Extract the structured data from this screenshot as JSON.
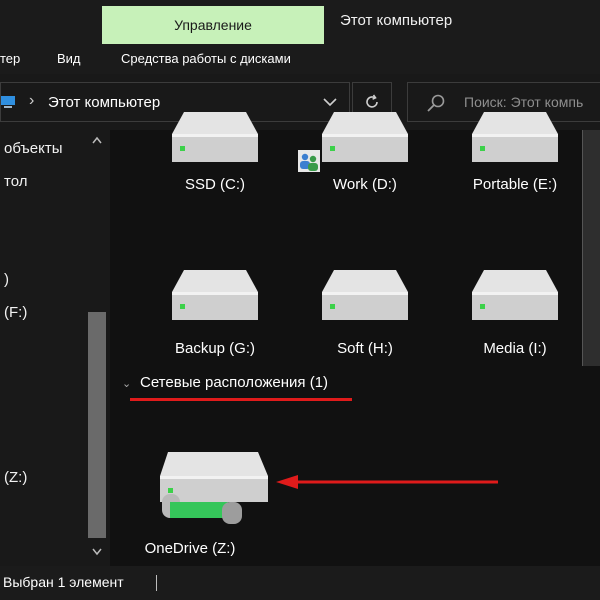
{
  "ribbon": {
    "active_context_tab": "Управление",
    "window_title": "Этот компьютер",
    "items": [
      "тер",
      "Вид",
      "Средства работы с дисками"
    ]
  },
  "address": {
    "path": "Этот компьютер",
    "search_placeholder": "Поиск: Этот компь"
  },
  "nav": {
    "items": [
      "объекты",
      "тол",
      ")",
      "(F:)",
      "(Z:)"
    ]
  },
  "drives": [
    {
      "label": "SSD (C:)",
      "shared": false
    },
    {
      "label": "Work (D:)",
      "shared": true
    },
    {
      "label": "Portable (E:)",
      "shared": false
    },
    {
      "label": "Backup (G:)",
      "shared": false
    },
    {
      "label": "Soft (H:)",
      "shared": false
    },
    {
      "label": "Media (I:)",
      "shared": false
    }
  ],
  "network_group": {
    "header": "Сетевые расположения (1)",
    "items": [
      {
        "label": "OneDrive  (Z:)"
      }
    ]
  },
  "status": {
    "selection": "Выбран 1 элемент"
  },
  "colors": {
    "ribbon_active_tab": "#c7f1b9",
    "annotation_red": "#e01b1b",
    "drive_led": "#3cd14a",
    "network_cable": "#35c65a"
  }
}
